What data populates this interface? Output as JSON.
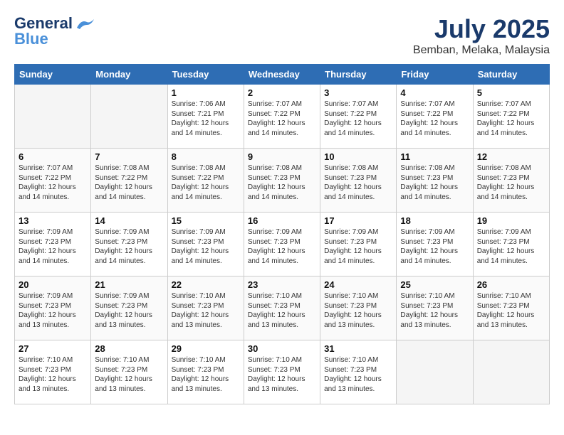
{
  "header": {
    "logo_line1": "General",
    "logo_line2": "Blue",
    "month_year": "July 2025",
    "location": "Bemban, Melaka, Malaysia"
  },
  "weekdays": [
    "Sunday",
    "Monday",
    "Tuesday",
    "Wednesday",
    "Thursday",
    "Friday",
    "Saturday"
  ],
  "weeks": [
    [
      {
        "day": "",
        "empty": true
      },
      {
        "day": "",
        "empty": true
      },
      {
        "day": "1",
        "sunrise": "Sunrise: 7:06 AM",
        "sunset": "Sunset: 7:21 PM",
        "daylight": "Daylight: 12 hours and 14 minutes."
      },
      {
        "day": "2",
        "sunrise": "Sunrise: 7:07 AM",
        "sunset": "Sunset: 7:22 PM",
        "daylight": "Daylight: 12 hours and 14 minutes."
      },
      {
        "day": "3",
        "sunrise": "Sunrise: 7:07 AM",
        "sunset": "Sunset: 7:22 PM",
        "daylight": "Daylight: 12 hours and 14 minutes."
      },
      {
        "day": "4",
        "sunrise": "Sunrise: 7:07 AM",
        "sunset": "Sunset: 7:22 PM",
        "daylight": "Daylight: 12 hours and 14 minutes."
      },
      {
        "day": "5",
        "sunrise": "Sunrise: 7:07 AM",
        "sunset": "Sunset: 7:22 PM",
        "daylight": "Daylight: 12 hours and 14 minutes."
      }
    ],
    [
      {
        "day": "6",
        "sunrise": "Sunrise: 7:07 AM",
        "sunset": "Sunset: 7:22 PM",
        "daylight": "Daylight: 12 hours and 14 minutes."
      },
      {
        "day": "7",
        "sunrise": "Sunrise: 7:08 AM",
        "sunset": "Sunset: 7:22 PM",
        "daylight": "Daylight: 12 hours and 14 minutes."
      },
      {
        "day": "8",
        "sunrise": "Sunrise: 7:08 AM",
        "sunset": "Sunset: 7:22 PM",
        "daylight": "Daylight: 12 hours and 14 minutes."
      },
      {
        "day": "9",
        "sunrise": "Sunrise: 7:08 AM",
        "sunset": "Sunset: 7:23 PM",
        "daylight": "Daylight: 12 hours and 14 minutes."
      },
      {
        "day": "10",
        "sunrise": "Sunrise: 7:08 AM",
        "sunset": "Sunset: 7:23 PM",
        "daylight": "Daylight: 12 hours and 14 minutes."
      },
      {
        "day": "11",
        "sunrise": "Sunrise: 7:08 AM",
        "sunset": "Sunset: 7:23 PM",
        "daylight": "Daylight: 12 hours and 14 minutes."
      },
      {
        "day": "12",
        "sunrise": "Sunrise: 7:08 AM",
        "sunset": "Sunset: 7:23 PM",
        "daylight": "Daylight: 12 hours and 14 minutes."
      }
    ],
    [
      {
        "day": "13",
        "sunrise": "Sunrise: 7:09 AM",
        "sunset": "Sunset: 7:23 PM",
        "daylight": "Daylight: 12 hours and 14 minutes."
      },
      {
        "day": "14",
        "sunrise": "Sunrise: 7:09 AM",
        "sunset": "Sunset: 7:23 PM",
        "daylight": "Daylight: 12 hours and 14 minutes."
      },
      {
        "day": "15",
        "sunrise": "Sunrise: 7:09 AM",
        "sunset": "Sunset: 7:23 PM",
        "daylight": "Daylight: 12 hours and 14 minutes."
      },
      {
        "day": "16",
        "sunrise": "Sunrise: 7:09 AM",
        "sunset": "Sunset: 7:23 PM",
        "daylight": "Daylight: 12 hours and 14 minutes."
      },
      {
        "day": "17",
        "sunrise": "Sunrise: 7:09 AM",
        "sunset": "Sunset: 7:23 PM",
        "daylight": "Daylight: 12 hours and 14 minutes."
      },
      {
        "day": "18",
        "sunrise": "Sunrise: 7:09 AM",
        "sunset": "Sunset: 7:23 PM",
        "daylight": "Daylight: 12 hours and 14 minutes."
      },
      {
        "day": "19",
        "sunrise": "Sunrise: 7:09 AM",
        "sunset": "Sunset: 7:23 PM",
        "daylight": "Daylight: 12 hours and 14 minutes."
      }
    ],
    [
      {
        "day": "20",
        "sunrise": "Sunrise: 7:09 AM",
        "sunset": "Sunset: 7:23 PM",
        "daylight": "Daylight: 12 hours and 13 minutes."
      },
      {
        "day": "21",
        "sunrise": "Sunrise: 7:09 AM",
        "sunset": "Sunset: 7:23 PM",
        "daylight": "Daylight: 12 hours and 13 minutes."
      },
      {
        "day": "22",
        "sunrise": "Sunrise: 7:10 AM",
        "sunset": "Sunset: 7:23 PM",
        "daylight": "Daylight: 12 hours and 13 minutes."
      },
      {
        "day": "23",
        "sunrise": "Sunrise: 7:10 AM",
        "sunset": "Sunset: 7:23 PM",
        "daylight": "Daylight: 12 hours and 13 minutes."
      },
      {
        "day": "24",
        "sunrise": "Sunrise: 7:10 AM",
        "sunset": "Sunset: 7:23 PM",
        "daylight": "Daylight: 12 hours and 13 minutes."
      },
      {
        "day": "25",
        "sunrise": "Sunrise: 7:10 AM",
        "sunset": "Sunset: 7:23 PM",
        "daylight": "Daylight: 12 hours and 13 minutes."
      },
      {
        "day": "26",
        "sunrise": "Sunrise: 7:10 AM",
        "sunset": "Sunset: 7:23 PM",
        "daylight": "Daylight: 12 hours and 13 minutes."
      }
    ],
    [
      {
        "day": "27",
        "sunrise": "Sunrise: 7:10 AM",
        "sunset": "Sunset: 7:23 PM",
        "daylight": "Daylight: 12 hours and 13 minutes."
      },
      {
        "day": "28",
        "sunrise": "Sunrise: 7:10 AM",
        "sunset": "Sunset: 7:23 PM",
        "daylight": "Daylight: 12 hours and 13 minutes."
      },
      {
        "day": "29",
        "sunrise": "Sunrise: 7:10 AM",
        "sunset": "Sunset: 7:23 PM",
        "daylight": "Daylight: 12 hours and 13 minutes."
      },
      {
        "day": "30",
        "sunrise": "Sunrise: 7:10 AM",
        "sunset": "Sunset: 7:23 PM",
        "daylight": "Daylight: 12 hours and 13 minutes."
      },
      {
        "day": "31",
        "sunrise": "Sunrise: 7:10 AM",
        "sunset": "Sunset: 7:23 PM",
        "daylight": "Daylight: 12 hours and 13 minutes."
      },
      {
        "day": "",
        "empty": true
      },
      {
        "day": "",
        "empty": true
      }
    ]
  ]
}
